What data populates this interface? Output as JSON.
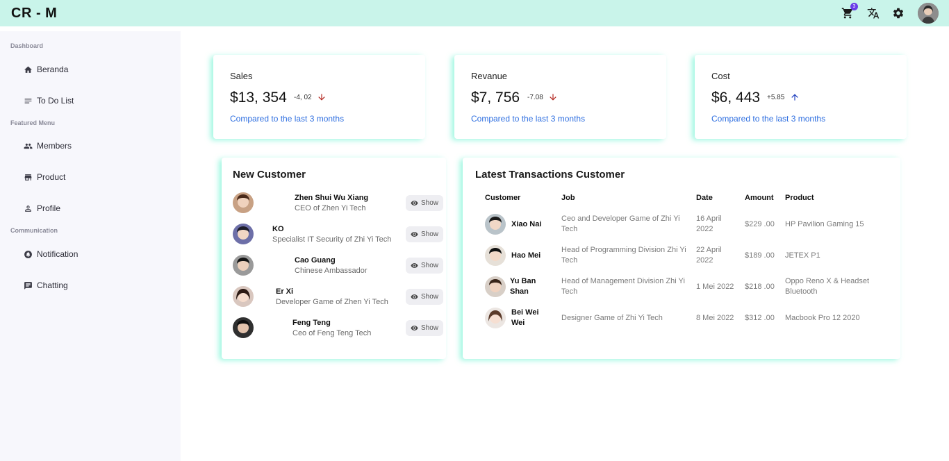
{
  "app": {
    "title": "CR - M"
  },
  "topbar": {
    "cart_count": "3"
  },
  "sidebar": {
    "sections": [
      {
        "label": "Dashboard",
        "items": [
          {
            "label": "Beranda",
            "icon": "home-icon"
          },
          {
            "label": "To Do List",
            "icon": "list-icon"
          }
        ]
      },
      {
        "label": "Featured Menu",
        "items": [
          {
            "label": "Members",
            "icon": "people-icon"
          },
          {
            "label": "Product",
            "icon": "store-icon"
          },
          {
            "label": "Profile",
            "icon": "person-icon"
          }
        ]
      },
      {
        "label": "Communication",
        "items": [
          {
            "label": "Notification",
            "icon": "bell-icon"
          },
          {
            "label": "Chatting",
            "icon": "chat-icon"
          }
        ]
      }
    ]
  },
  "stats": [
    {
      "title": "Sales",
      "value": "$13, 354",
      "delta": "-4, 02",
      "trend": "down",
      "link": "Compared to the last 3 months"
    },
    {
      "title": "Revanue",
      "value": "$7, 756",
      "delta": "-7.08",
      "trend": "down",
      "link": "Compared to the last 3 months"
    },
    {
      "title": "Cost",
      "value": "$6, 443",
      "delta": "+5.85",
      "trend": "up",
      "link": "Compared to the last 3 months"
    }
  ],
  "colors": {
    "topbar": "#c9f4ea",
    "accent_glow": "#50f0c8",
    "link": "#2f6fe0",
    "down": "#b3261e",
    "up": "#1f3fbf",
    "badge": "#6a3de8"
  },
  "new_customer": {
    "title": "New Customer",
    "show_label": "Show",
    "items": [
      {
        "name": "Zhen Shui Wu Xiang",
        "role": "CEO of Zhen Yi Tech"
      },
      {
        "name": "KO",
        "role": "Specialist IT Security of Zhi Yi Tech"
      },
      {
        "name": "Cao Guang",
        "role": "Chinese Ambassador"
      },
      {
        "name": "Er Xi",
        "role": "Developer Game of Zhen Yi Tech"
      },
      {
        "name": "Feng Teng",
        "role": "Ceo of Feng Teng Tech"
      }
    ]
  },
  "transactions": {
    "title": "Latest Transactions Customer",
    "headers": {
      "customer": "Customer",
      "job": "Job",
      "date": "Date",
      "amount": "Amount",
      "product": "Product"
    },
    "rows": [
      {
        "customer": "Xiao Nai",
        "job": "Ceo and Developer Game of Zhi Yi Tech",
        "date": "16 April 2022",
        "amount": "$229 .00",
        "product": "HP Pavilion Gaming 15"
      },
      {
        "customer": "Hao Mei",
        "job": "Head of Programming Division Zhi Yi Tech",
        "date": "22 April 2022",
        "amount": "$189 .00",
        "product": "JETEX P1"
      },
      {
        "customer": "Yu Ban Shan",
        "job": "Head of Management Division Zhi Yi Tech",
        "date": "1 Mei 2022",
        "amount": "$218 .00",
        "product": "Oppo Reno X & Headset Bluetooth"
      },
      {
        "customer": "Bei Wei Wei",
        "job": "Designer Game of Zhi Yi Tech",
        "date": "8 Mei 2022",
        "amount": "$312 .00",
        "product": "Macbook Pro 12 2020"
      }
    ]
  }
}
